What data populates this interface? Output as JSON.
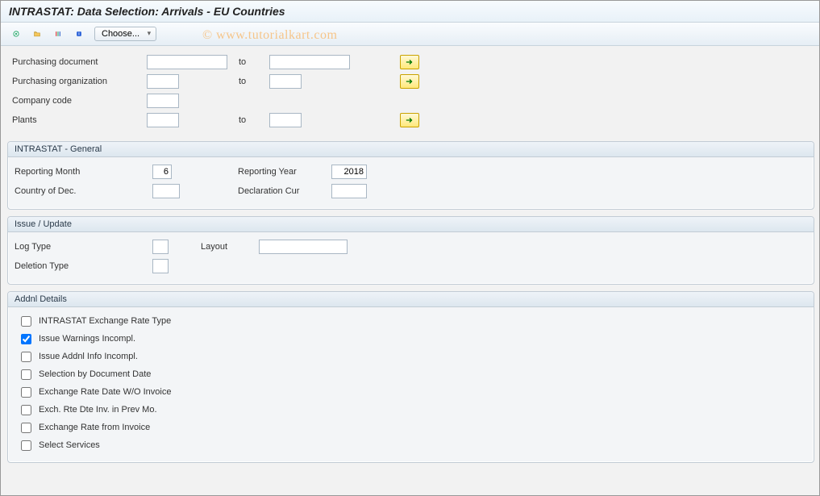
{
  "title": "INTRASTAT: Data Selection: Arrivals - EU Countries",
  "watermark": "© www.tutorialkart.com",
  "toolbar": {
    "choose_label": "Choose..."
  },
  "selection": {
    "purchasing_document": {
      "label": "Purchasing document",
      "from": "",
      "to_label": "to",
      "to": ""
    },
    "purchasing_org": {
      "label": "Purchasing organization",
      "from": "",
      "to_label": "to",
      "to": ""
    },
    "company_code": {
      "label": "Company code",
      "from": ""
    },
    "plants": {
      "label": "Plants",
      "from": "",
      "to_label": "to",
      "to": ""
    }
  },
  "general": {
    "panel_title": "INTRASTAT - General",
    "reporting_month_label": "Reporting Month",
    "reporting_month": "6",
    "reporting_year_label": "Reporting Year",
    "reporting_year": "2018",
    "country_label": "Country of Dec.",
    "country": "",
    "decl_cur_label": "Declaration Cur",
    "decl_cur": ""
  },
  "issue": {
    "panel_title": "Issue / Update",
    "log_type_label": "Log Type",
    "log_type": "",
    "layout_label": "Layout",
    "layout": "",
    "deletion_type_label": "Deletion Type",
    "deletion_type": ""
  },
  "addnl": {
    "panel_title": "Addnl Details",
    "items": [
      {
        "label": "INTRASTAT Exchange Rate Type",
        "checked": false
      },
      {
        "label": "Issue Warnings Incompl.",
        "checked": true
      },
      {
        "label": "Issue Addnl Info Incompl.",
        "checked": false
      },
      {
        "label": "Selection by Document Date",
        "checked": false
      },
      {
        "label": "Exchange Rate Date W/O Invoice",
        "checked": false
      },
      {
        "label": "Exch. Rte Dte Inv. in Prev Mo.",
        "checked": false
      },
      {
        "label": "Exchange Rate from Invoice",
        "checked": false
      },
      {
        "label": "Select Services",
        "checked": false
      }
    ]
  }
}
